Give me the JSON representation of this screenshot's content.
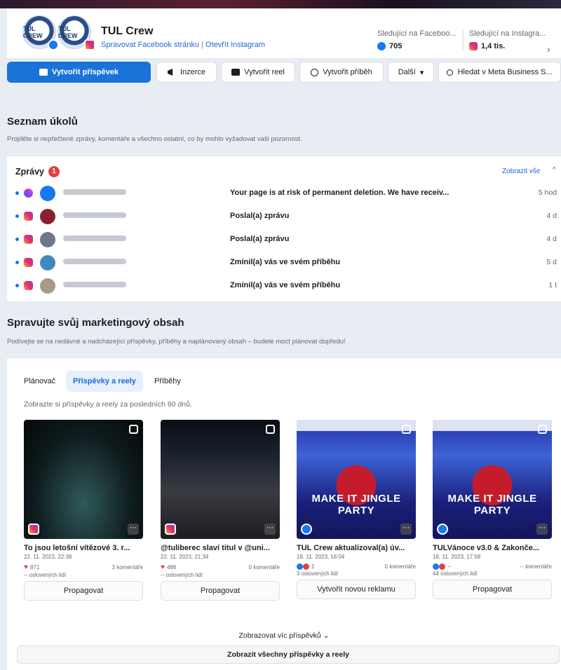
{
  "header": {
    "page_name": "TUL Crew",
    "avatar_text": "TUL CREW",
    "link_manage_fb": "Spravovat Facebook stránku",
    "link_sep": "|",
    "link_open_ig": "Otevřít Instagram",
    "fb_followers_label": "Sledující na Faceboo...",
    "fb_followers_value": "705",
    "ig_followers_label": "Sledující na Instagra...",
    "ig_followers_value": "1,4 tis.",
    "next_chevron": "›"
  },
  "toolbar": {
    "create_post": "Vytvořit příspěvek",
    "ads": "Inzerce",
    "create_reel": "Vytvořit reel",
    "create_story": "Vytvořit příběh",
    "more": "Další",
    "more_caret": "▾",
    "search": "Hledat v Meta Business S..."
  },
  "tasks": {
    "title": "Seznam úkolů",
    "subtitle": "Projděte si nepřečtené zprávy, komentáře a všechno ostatní, co by mohlo vyžadovat vaši pozornost.",
    "messages_label": "Zprávy",
    "messages_count": "1",
    "see_all": "Zobrazit vše",
    "collapse_caret": "^",
    "rows": [
      {
        "platform": "messenger",
        "text": "Your page is at risk of permanent deletion. We have receiv...",
        "time": "5 hod"
      },
      {
        "platform": "instagram",
        "text": "Poslal(a) zprávu",
        "time": "4 d"
      },
      {
        "platform": "instagram",
        "text": "Poslal(a) zprávu",
        "time": "4 d"
      },
      {
        "platform": "instagram",
        "text": "Zmínil(a) vás ve svém příběhu",
        "time": "5 d"
      },
      {
        "platform": "instagram",
        "text": "Zmínil(a) vás ve svém příběhu",
        "time": "1 t"
      }
    ]
  },
  "marketing": {
    "title": "Spravujte svůj marketingový obsah",
    "subtitle": "Podívejte se na nedávné a nadcházející příspěvky, příběhy a naplánovaný obsah – budete moct plánovat dopředu!",
    "tabs": [
      "Plánovač",
      "Příspěvky a reely",
      "Příběhy"
    ],
    "active_tab": "Příspěvky a reely",
    "period_note": "Zobrazte si příspěvky a reely za posledních 60 dnů.",
    "posts": [
      {
        "title": "To jsou letošní vítězové 3. r...",
        "date": "22. 11. 2023, 22:38",
        "reactions": "871",
        "comments": "3 komentáře",
        "reach": "-- oslovených lidí",
        "button": "Propagovat",
        "platform": "instagram"
      },
      {
        "title": "@tuliberec slaví titul v @uni...",
        "date": "22. 11. 2023, 21:34",
        "reactions": "486",
        "comments": "0 komentáře",
        "reach": "-- oslovených lidí",
        "button": "Propagovat",
        "platform": "instagram"
      },
      {
        "title": "TUL Crew aktualizoval(a) úv...",
        "date": "18. 11. 2023, 18:04",
        "reactions": "1",
        "comments": "0 komentáře",
        "reach": "3 oslovených lidí",
        "button": "Vytvořit novou reklamu",
        "platform": "facebook",
        "image_text": "MAKE IT JINGLE PARTY"
      },
      {
        "title": "TULVánoce v3.0 & Zakonče...",
        "date": "18. 11. 2023, 17:58",
        "reactions": "--",
        "comments": "-- komentáře",
        "reach": "44 oslovených lidí",
        "button": "Propagovat",
        "platform": "facebook",
        "image_text": "MAKE IT JINGLE PARTY"
      }
    ],
    "more_posts": "Zobrazovat víc příspěvků",
    "more_caret": "⌄",
    "all_posts": "Zobrazit všechny příspěvky a reely"
  },
  "colors": {
    "accent": "#1a73d9",
    "link": "#1a6bd0",
    "badge": "#e0423b"
  }
}
